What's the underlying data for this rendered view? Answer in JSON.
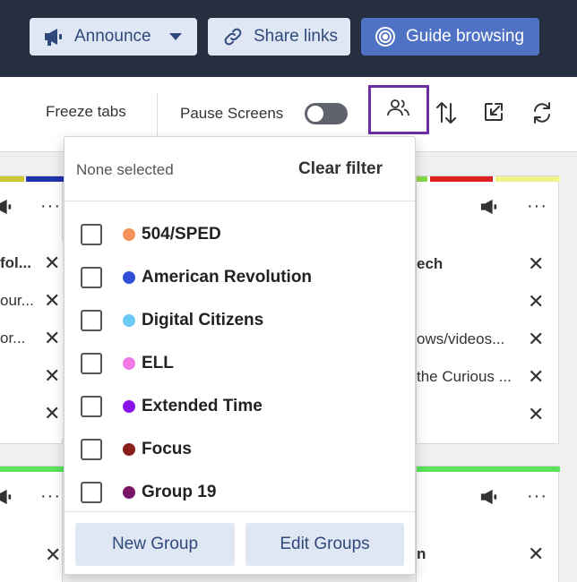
{
  "topbar": {
    "announce_label": "Announce",
    "share_label": "Share links",
    "guide_label": "Guide browsing",
    "icons": [
      "megaphone-icon",
      "caret-down-icon",
      "link-icon",
      "target-icon"
    ]
  },
  "toolbar": {
    "freeze_label": "Freeze tabs",
    "pause_label": "Pause Screens",
    "pause_on": false,
    "icons": [
      "users-icon",
      "sort-icon",
      "shrink-icon",
      "refresh-icon"
    ]
  },
  "cards": {
    "left_rows": [
      "fol...",
      "our...",
      "or...",
      "",
      ""
    ],
    "right_rows": [
      "ech",
      "",
      "ows/videos...",
      "the Curious ...",
      ""
    ],
    "right_bottom_rows": [
      "n"
    ],
    "stripe_colors_left": [
      "#c8c92a",
      "#2233aa"
    ],
    "stripe_colors_right": [
      "#88d944",
      "#dd2222",
      "#f4f08a"
    ],
    "stripe_bottom": "#5be35b"
  },
  "filter": {
    "none_selected": "None selected",
    "clear_label": "Clear filter",
    "items": [
      {
        "label": "504/SPED",
        "color": "#f5925a"
      },
      {
        "label": "American Revolution",
        "color": "#2f4fd8"
      },
      {
        "label": "Digital Citizens",
        "color": "#6cc8f5"
      },
      {
        "label": "ELL",
        "color": "#f07ae6"
      },
      {
        "label": "Extended Time",
        "color": "#8a14e8"
      },
      {
        "label": "Focus",
        "color": "#8c1d1d"
      },
      {
        "label": "Group 19",
        "color": "#7a1468"
      }
    ],
    "new_group_label": "New Group",
    "edit_groups_label": "Edit Groups"
  }
}
